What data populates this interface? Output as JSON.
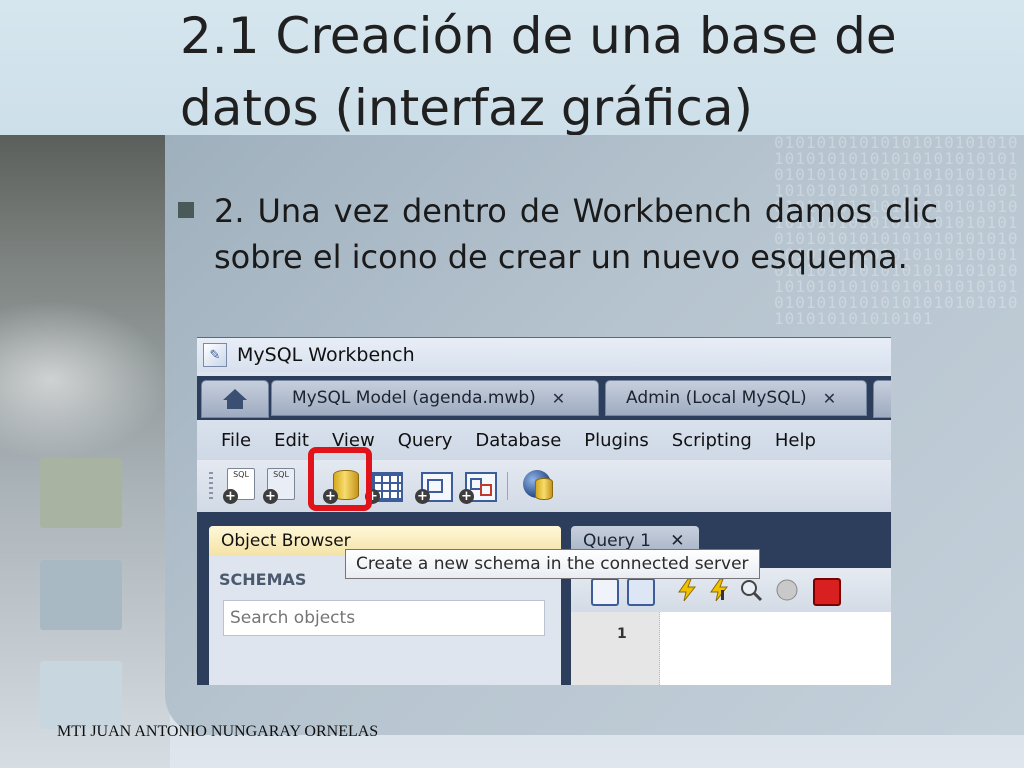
{
  "slide": {
    "title": "2.1 Creación de una base de datos (interfaz gráfica)",
    "bullet_text": "2. Una vez dentro de Workbench damos clic sobre el icono de crear un nuevo esquema.",
    "footer": "MTI JUAN ANTONIO NUNGARAY ORNELAS",
    "binary_pattern": "0101010101010101010101010101010101010101010101010101010101010101010101010101010101010101010101010101010101010101010101010101010101010101010101010101010101010101010101010101010101010101010101010101010101010101010101010101010101010101010101010101010101010101010101010101"
  },
  "workbench": {
    "window_title": "MySQL Workbench",
    "tabs": [
      {
        "label": "MySQL Model (agenda.mwb)",
        "close": "✕"
      },
      {
        "label": "Admin (Local MySQL)",
        "close": "✕"
      }
    ],
    "menu": [
      "File",
      "Edit",
      "View",
      "Query",
      "Database",
      "Plugins",
      "Scripting",
      "Help"
    ],
    "toolbar": {
      "sql_icon_label": "SQL",
      "plus_glyph": "+"
    },
    "object_browser": {
      "tab_label": "Object Browser",
      "schemas_label": "SCHEMAS",
      "search_placeholder": "Search objects"
    },
    "query_tab": {
      "label": "Query 1",
      "close": "✕"
    },
    "editor": {
      "line_number": "1"
    },
    "tooltip": "Create a new schema in the connected server"
  },
  "colors": {
    "highlight": "#e0131a",
    "dark_frame": "#2d3e5c"
  }
}
